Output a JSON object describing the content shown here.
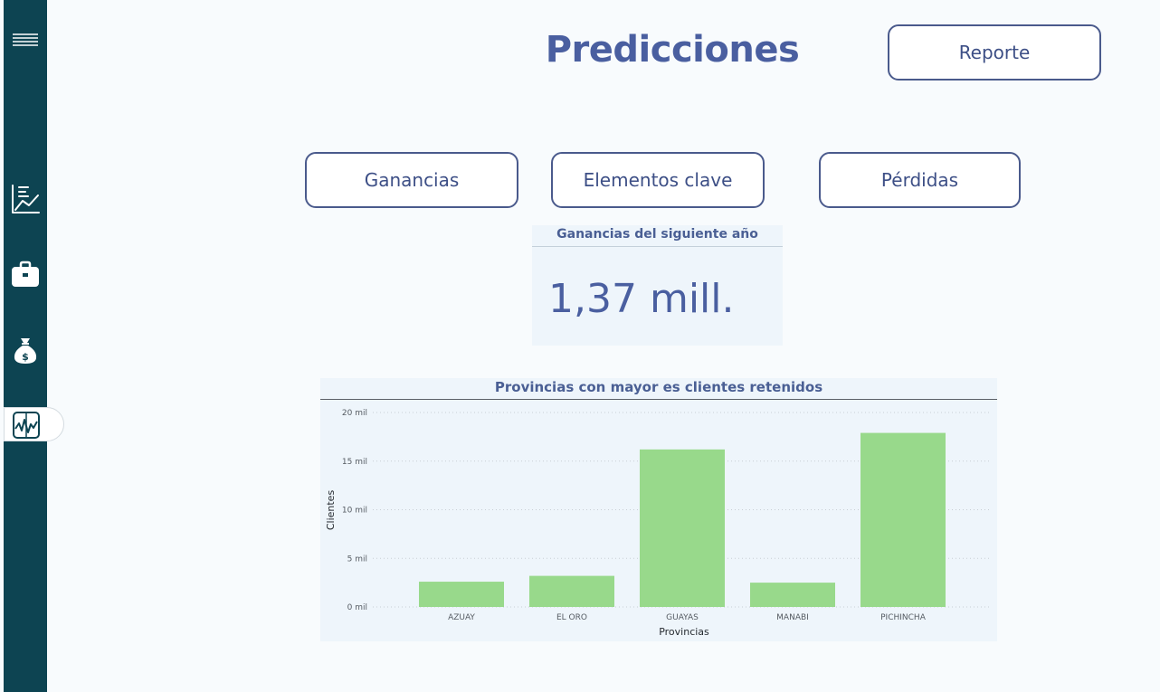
{
  "page": {
    "title": "Predicciones",
    "report_button": "Reporte"
  },
  "sidebar": {
    "items": [
      {
        "icon": "hamburger-menu-icon",
        "active": false
      },
      {
        "icon": "line-chart-icon",
        "active": false
      },
      {
        "icon": "briefcase-icon",
        "active": false
      },
      {
        "icon": "money-bag-icon",
        "active": false
      },
      {
        "icon": "pulse-chart-icon",
        "active": true
      }
    ]
  },
  "nav": {
    "ganancias": "Ganancias",
    "elementos_clave": "Elementos clave",
    "perdidas": "Pérdidas"
  },
  "card": {
    "title": "Ganancias del siguiente año",
    "value": "1,37 mill."
  },
  "colors": {
    "sidebar": "#0d4452",
    "accent": "#4a5fa0",
    "bar": "#98d98b",
    "panel": "#eef5fb"
  },
  "chart_data": {
    "type": "bar",
    "title": "Provincias con mayor es clientes retenidos",
    "xlabel": "Provincias",
    "ylabel": "Clientes",
    "categories": [
      "AZUAY",
      "EL ORO",
      "GUAYAS",
      "MANABI",
      "PICHINCHA"
    ],
    "values": [
      2600,
      3200,
      16200,
      2500,
      17900
    ],
    "ylim": [
      0,
      20000
    ],
    "yticks": [
      {
        "value": 0,
        "label": "0 mil"
      },
      {
        "value": 5000,
        "label": "5 mil"
      },
      {
        "value": 10000,
        "label": "10 mil"
      },
      {
        "value": 15000,
        "label": "15 mil"
      },
      {
        "value": 20000,
        "label": "20 mil"
      }
    ],
    "grid": true,
    "color": "#98d98b"
  }
}
